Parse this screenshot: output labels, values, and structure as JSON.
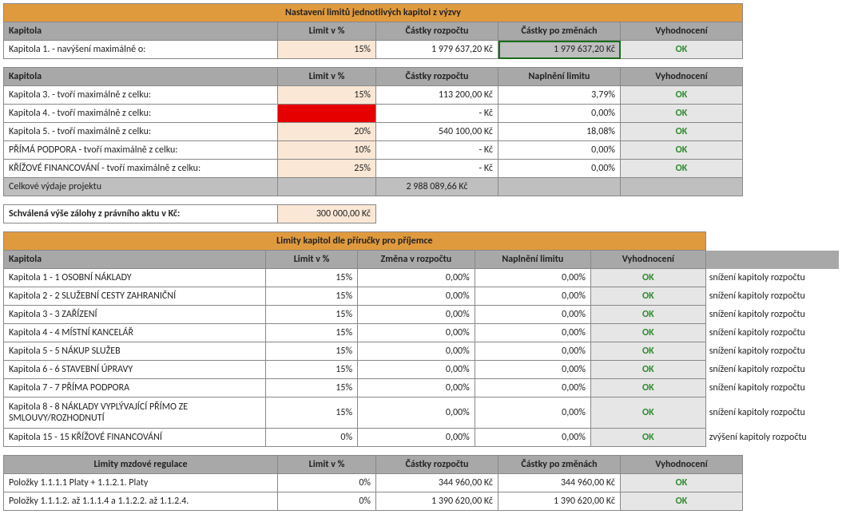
{
  "colors": {
    "header": "#e09a3e",
    "headerRow": "#a8a8a8",
    "paleOrange": "#fbe7d5",
    "red": "#e60000",
    "grey": "#bfbfbf",
    "ltGrey": "#e6e6e6",
    "ok": "#2e8b2e"
  },
  "section1": {
    "title": "Nastavení limitů jednotlivých kapitol z výzvy",
    "headers": {
      "kapitola": "Kapitola",
      "limit": "Limit v %",
      "castky": "Částky rozpočtu",
      "zmeny": "Částky po změnách",
      "eval": "Vyhodnocení"
    },
    "row1": {
      "label": "Kapitola 1. - navýšení maximálně o:",
      "limit": "15%",
      "rozpocet": "1 979 637,20 Kč",
      "zmeny": "1 979 637,20 Kč",
      "eval": "OK"
    }
  },
  "section2": {
    "headers": {
      "kapitola": "Kapitola",
      "limit": "Limit v %",
      "castky": "Částky rozpočtu",
      "naplneni": "Naplnění limitu",
      "eval": "Vyhodnocení"
    },
    "rows": [
      {
        "label": "Kapitola 3. - tvoří maximálně z celku:",
        "limit": "15%",
        "rozpocet": "113 200,00 Kč",
        "naplneni": "3,79%",
        "eval": "OK",
        "limitClass": "pale-orange"
      },
      {
        "label": "Kapitola 4. - tvoří maximálně z celku:",
        "limit": "",
        "rozpocet": "-   Kč",
        "naplneni": "0,00%",
        "eval": "OK",
        "limitClass": "red-cell"
      },
      {
        "label": "Kapitola 5. - tvoří maximálně z celku:",
        "limit": "20%",
        "rozpocet": "540 100,00 Kč",
        "naplneni": "18,08%",
        "eval": "OK",
        "limitClass": "pale-orange"
      },
      {
        "label": "PŘÍMÁ PODPORA - tvoří maximálně z celku:",
        "limit": "10%",
        "rozpocet": "-   Kč",
        "naplneni": "0,00%",
        "eval": "OK",
        "limitClass": "pale-orange"
      },
      {
        "label": "KŘÍŽOVÉ FINANCOVÁNÍ - tvoří maximálně z celku:",
        "limit": "25%",
        "rozpocet": "-   Kč",
        "naplneni": "0,00%",
        "eval": "OK",
        "limitClass": "pale-orange"
      }
    ],
    "total": {
      "label": "Celkové výdaje projektu",
      "value": "2 988 089,66 Kč"
    }
  },
  "zaloha": {
    "label": "Schválená výše zálohy z právního aktu v Kč:",
    "value": "300 000,00 Kč"
  },
  "section3": {
    "title": "Limity kapitol dle příručky pro příjemce",
    "headers": {
      "kapitola": "Kapitola",
      "limit": "Limit v %",
      "zmena": "Změna v rozpočtu",
      "naplneni": "Naplnění limitu",
      "eval": "Vyhodnocení"
    },
    "rows": [
      {
        "label": "Kapitola 1 - 1 OSOBNÍ NÁKLADY",
        "limit": "15%",
        "zmena": "0,00%",
        "naplneni": "0,00%",
        "eval": "OK",
        "note": "snížení kapitoly rozpočtu"
      },
      {
        "label": "Kapitola 2 - 2 SLUŽEBNÍ CESTY ZAHRANIČNÍ",
        "limit": "15%",
        "zmena": "0,00%",
        "naplneni": "0,00%",
        "eval": "OK",
        "note": "snížení kapitoly rozpočtu"
      },
      {
        "label": "Kapitola 3 - 3 ZAŘÍZENÍ",
        "limit": "15%",
        "zmena": "0,00%",
        "naplneni": "0,00%",
        "eval": "OK",
        "note": "snížení kapitoly rozpočtu"
      },
      {
        "label": "Kapitola 4 - 4 MÍSTNÍ KANCELÁŘ",
        "limit": "15%",
        "zmena": "0,00%",
        "naplneni": "0,00%",
        "eval": "OK",
        "note": "snížení kapitoly rozpočtu"
      },
      {
        "label": "Kapitola 5 - 5 NÁKUP SLUŽEB",
        "limit": "15%",
        "zmena": "0,00%",
        "naplneni": "0,00%",
        "eval": "OK",
        "note": "snížení kapitoly rozpočtu"
      },
      {
        "label": "Kapitola 6 - 6 STAVEBNÍ ÚPRAVY",
        "limit": "15%",
        "zmena": "0,00%",
        "naplneni": "0,00%",
        "eval": "OK",
        "note": "snížení kapitoly rozpočtu"
      },
      {
        "label": "Kapitola 7 - 7 PŘÍMA PODPORA",
        "limit": "15%",
        "zmena": "0,00%",
        "naplneni": "0,00%",
        "eval": "OK",
        "note": "snížení kapitoly rozpočtu"
      },
      {
        "label": "Kapitola 8 - 8 NÁKLADY VYPLÝVAJÍCÍ PŘÍMO ZE SMLOUVY/ROZHODNUTÍ",
        "limit": "15%",
        "zmena": "0,00%",
        "naplneni": "0,00%",
        "eval": "OK",
        "note": "snížení kapitoly rozpočtu",
        "wrap": true
      },
      {
        "label": "Kapitola 15 - 15 KŘÍŽOVÉ FINANCOVÁNÍ",
        "limit": "0%",
        "zmena": "0,00%",
        "naplneni": "0,00%",
        "eval": "OK",
        "note": "zvýšení kapitoly rozpočtu"
      }
    ]
  },
  "section4": {
    "title": "Limity mzdové regulace",
    "headers": {
      "limit": "Limit v %",
      "castky": "Částky rozpočtu",
      "zmeny": "Částky po změnách",
      "eval": "Vyhodnocení"
    },
    "rows": [
      {
        "label": "Položky 1.1.1.1 Platy + 1.1.2.1. Platy",
        "limit": "0%",
        "rozpocet": "344 960,00 Kč",
        "zmeny": "344 960,00 Kč",
        "eval": "OK"
      },
      {
        "label": "Položky 1.1.1.2. až 1.1.1.4 a 1.1.2.2. až 1.1.2.4.",
        "limit": "0%",
        "rozpocet": "1 390 620,00 Kč",
        "zmeny": "1 390 620,00 Kč",
        "eval": "OK"
      }
    ]
  }
}
